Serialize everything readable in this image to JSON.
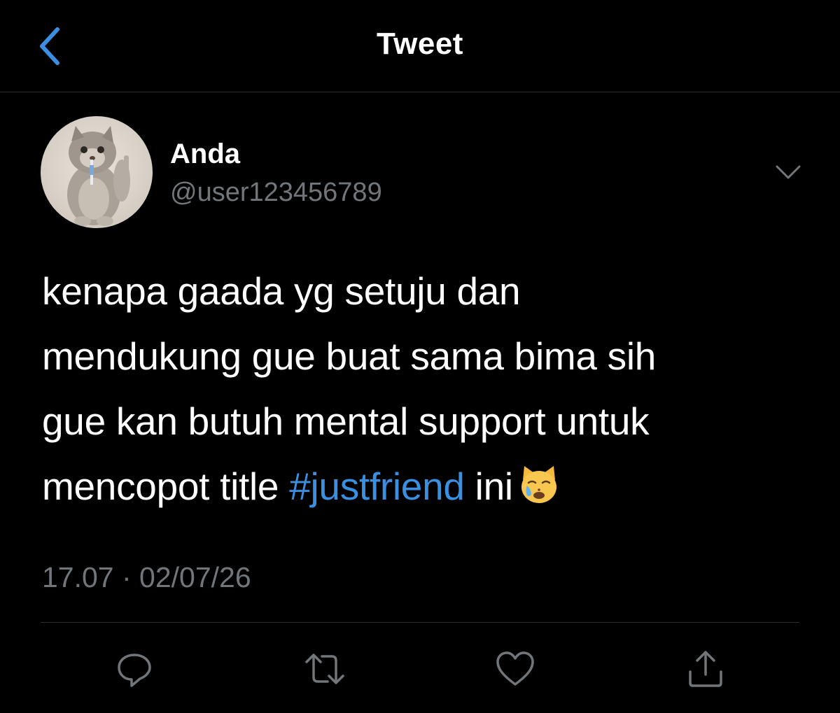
{
  "header": {
    "title": "Tweet",
    "back_icon": "chevron-left-icon"
  },
  "author": {
    "display_name": "Anda",
    "handle": "@user123456789"
  },
  "tweet": {
    "lines": [
      "kenapa gaada yg setuju dan",
      "mendukung gue buat sama bima sih",
      "gue kan butuh mental support untuk"
    ],
    "last_line_prefix": "mencopot title ",
    "hashtag": "#justfriend",
    "last_line_suffix": " ini",
    "emoji": "crying-cat-emoji",
    "timestamp": "17.07 · 02/07/26"
  },
  "actions": [
    "reply-icon",
    "retweet-icon",
    "like-icon",
    "share-icon"
  ],
  "colors": {
    "background": "#000000",
    "text": "#ffffff",
    "secondary_text": "#71767b",
    "accent": "#3b8fe0",
    "divider": "#2a2d30"
  }
}
